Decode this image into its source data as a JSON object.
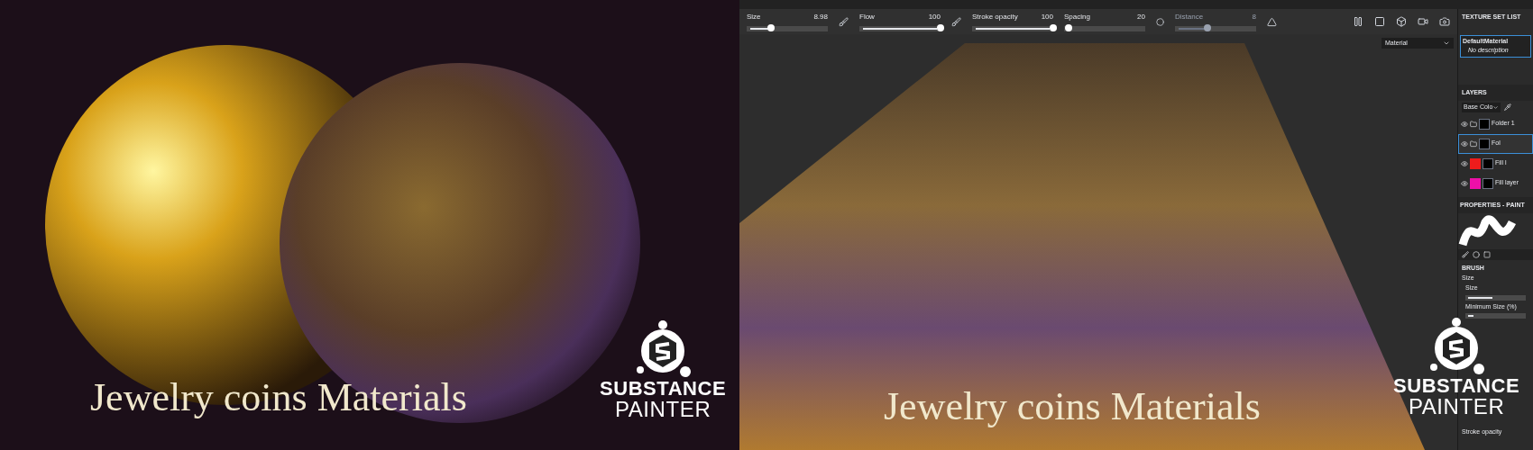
{
  "left_panel": {
    "title": "Jewelry coins Materials",
    "logo": {
      "line_1": "SUBSTANCE",
      "line_2": "PAINTER"
    }
  },
  "toolbar": {
    "sliders": [
      {
        "label": "Size",
        "value": "8.98",
        "level": 0.3,
        "disabled": false
      },
      {
        "label": "Flow",
        "value": "100",
        "level": 1,
        "disabled": false
      },
      {
        "label": "Stroke opacity",
        "value": "100",
        "level": 1,
        "disabled": false
      },
      {
        "label": "Spacing",
        "value": "20",
        "level": 0.05,
        "disabled": false
      },
      {
        "label": "Distance",
        "value": "8",
        "level": 0.4,
        "disabled": true
      }
    ]
  },
  "viewport": {
    "material_dropdown": "Material",
    "title": "Jewelry coins Materials",
    "logo": {
      "line_1": "SUBSTANCE",
      "line_2": "PAINTER"
    }
  },
  "texture_set_list": {
    "title": "TEXTURE SET LIST",
    "items": [
      {
        "name": "DefaultMaterial",
        "description": "No description",
        "selected": true
      }
    ]
  },
  "layers": {
    "title": "LAYERS",
    "channel": "Base Colo",
    "items": [
      {
        "name": "Folder 1",
        "kind": "folder",
        "selected": false
      },
      {
        "name": "Fol",
        "kind": "folder",
        "selected": true
      },
      {
        "name": "Fill l",
        "kind": "fill",
        "selected": false,
        "color": "#ee1c1c"
      },
      {
        "name": "Fill layer",
        "kind": "fill",
        "selected": false,
        "color": "#ee10a8"
      }
    ]
  },
  "properties": {
    "title": "PROPERTIES - PAINT",
    "section": "BRUSH",
    "group_label": "Size",
    "sliders": [
      {
        "label": "Size",
        "level": 0.45
      },
      {
        "label": "Minimum Size (%)",
        "level": 0.1
      }
    ],
    "footer_label": "Stroke opacity"
  }
}
